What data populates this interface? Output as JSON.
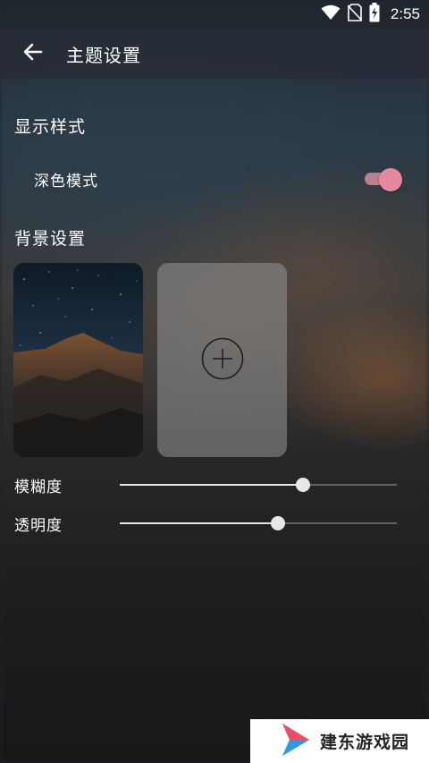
{
  "status_bar": {
    "time": "2:55",
    "icons": [
      "wifi-icon",
      "no-sim-icon",
      "battery-charging-icon"
    ]
  },
  "app_bar": {
    "back_icon": "arrow-left-icon",
    "title": "主题设置"
  },
  "display_section": {
    "title": "显示样式",
    "dark_mode": {
      "label": "深色模式",
      "enabled": true
    }
  },
  "background_section": {
    "title": "背景设置",
    "thumbnails": [
      {
        "kind": "image",
        "description_icon": "mountain-night-image"
      },
      {
        "kind": "add",
        "icon": "plus-circle-icon"
      }
    ]
  },
  "sliders": [
    {
      "label": "模糊度",
      "value": 0.66
    },
    {
      "label": "透明度",
      "value": 0.57
    }
  ],
  "watermark": {
    "text": "建东游戏园",
    "logo": "play-logo-icon"
  },
  "colors": {
    "accent": "#e5899f",
    "app_bar": "#2a2f38"
  }
}
